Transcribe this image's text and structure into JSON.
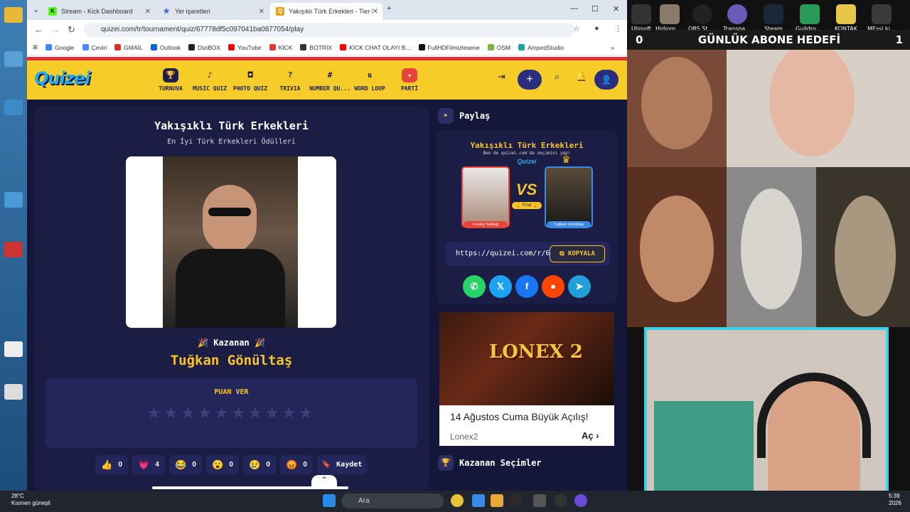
{
  "browser": {
    "tabs": [
      {
        "label": "Stream - Kick Dashboard",
        "fav": "K",
        "color": "#53fc18"
      },
      {
        "label": "Yer işaretleri",
        "fav": "★",
        "color": "#4a6ad8"
      },
      {
        "label": "Yakışıklı Türk Erkekleri - Tier List",
        "fav": "Q",
        "color": "#e8a11a"
      }
    ],
    "url": "quizei.com/tr/tournament/quiz/67778df5c097041ba0877054/play",
    "bookmarks": [
      "Google",
      "Çeviri",
      "GMAİL",
      "Outlook",
      "DiziBOX",
      "YouTube",
      "KİCK",
      "BOTRİX",
      "KİCK CHAT OLAYI B...",
      "FullHDFilmizlesene",
      "OSM",
      "AmpedStudio"
    ]
  },
  "site": {
    "logo": "Quizei",
    "nav": [
      "TURNUVA",
      "MUSIC QUIZ",
      "PHOTO QUIZ",
      "TRIVIA",
      "NUMBER QU...",
      "WORD LOOP",
      "PARTİ"
    ],
    "nav_icons": [
      "trophy-icon",
      "music-note-icon",
      "camera-icon",
      "question-icon",
      "hash-icon",
      "sort-icon",
      "party-icon"
    ]
  },
  "result": {
    "title": "Yakışıklı Türk Erkekleri",
    "subtitle": "En İyi Türk Erkekleri Ödülleri",
    "winner_label": "🎉  Kazanan  🎉",
    "winner_name": "Tuğkan Gönültaş",
    "rate_title": "PUAN VER",
    "stars": "★★★★★★★★★★",
    "reactions": [
      {
        "emoji": "👍",
        "count": "0"
      },
      {
        "emoji": "💗",
        "count": "4"
      },
      {
        "emoji": "😂",
        "count": "0"
      },
      {
        "emoji": "😮",
        "count": "0"
      },
      {
        "emoji": "😢",
        "count": "0"
      },
      {
        "emoji": "😡",
        "count": "0"
      }
    ],
    "save_label": "Kaydet"
  },
  "share": {
    "heading": "Paylaş",
    "card_title": "Yakışıklı Türk Erkekleri",
    "card_sub": "Ben de quizei.com'da seçimini yap!",
    "card_logo": "Quizei",
    "vs": "VS",
    "final": "🏆 Final 🏆",
    "left_name": "Kıvanç Tatlıtuğ",
    "right_name": "Tuğkan Gönültaş",
    "url": "https://quizei.com/r/6",
    "copy_label": "KOPYALA",
    "social": [
      "whatsapp-icon",
      "x-icon",
      "facebook-icon",
      "reddit-icon",
      "telegram-icon"
    ]
  },
  "ad": {
    "logo": "LONEX 2",
    "headline": "14 Ağustos Cuma Büyük Açılış!",
    "brand": "Lonex2",
    "cta": "Aç"
  },
  "picks": {
    "heading": "Kazanan Seçimler"
  },
  "overlay": {
    "goal": "GÜNLÜK ABONE HEDEFİ",
    "goal_left": "0",
    "goal_right": "1",
    "desktop_icons": [
      "Ubisoft",
      "Hidiom Online",
      "OBS Studio",
      "Transparent",
      "Steam",
      "Guildron Demo",
      "KONTAK",
      "MEssi kime"
    ]
  },
  "taskbar": {
    "temp": "28°C",
    "weather": "Kısmen güneşli",
    "search": "Ara",
    "time": "5:39",
    "year": "2026"
  }
}
